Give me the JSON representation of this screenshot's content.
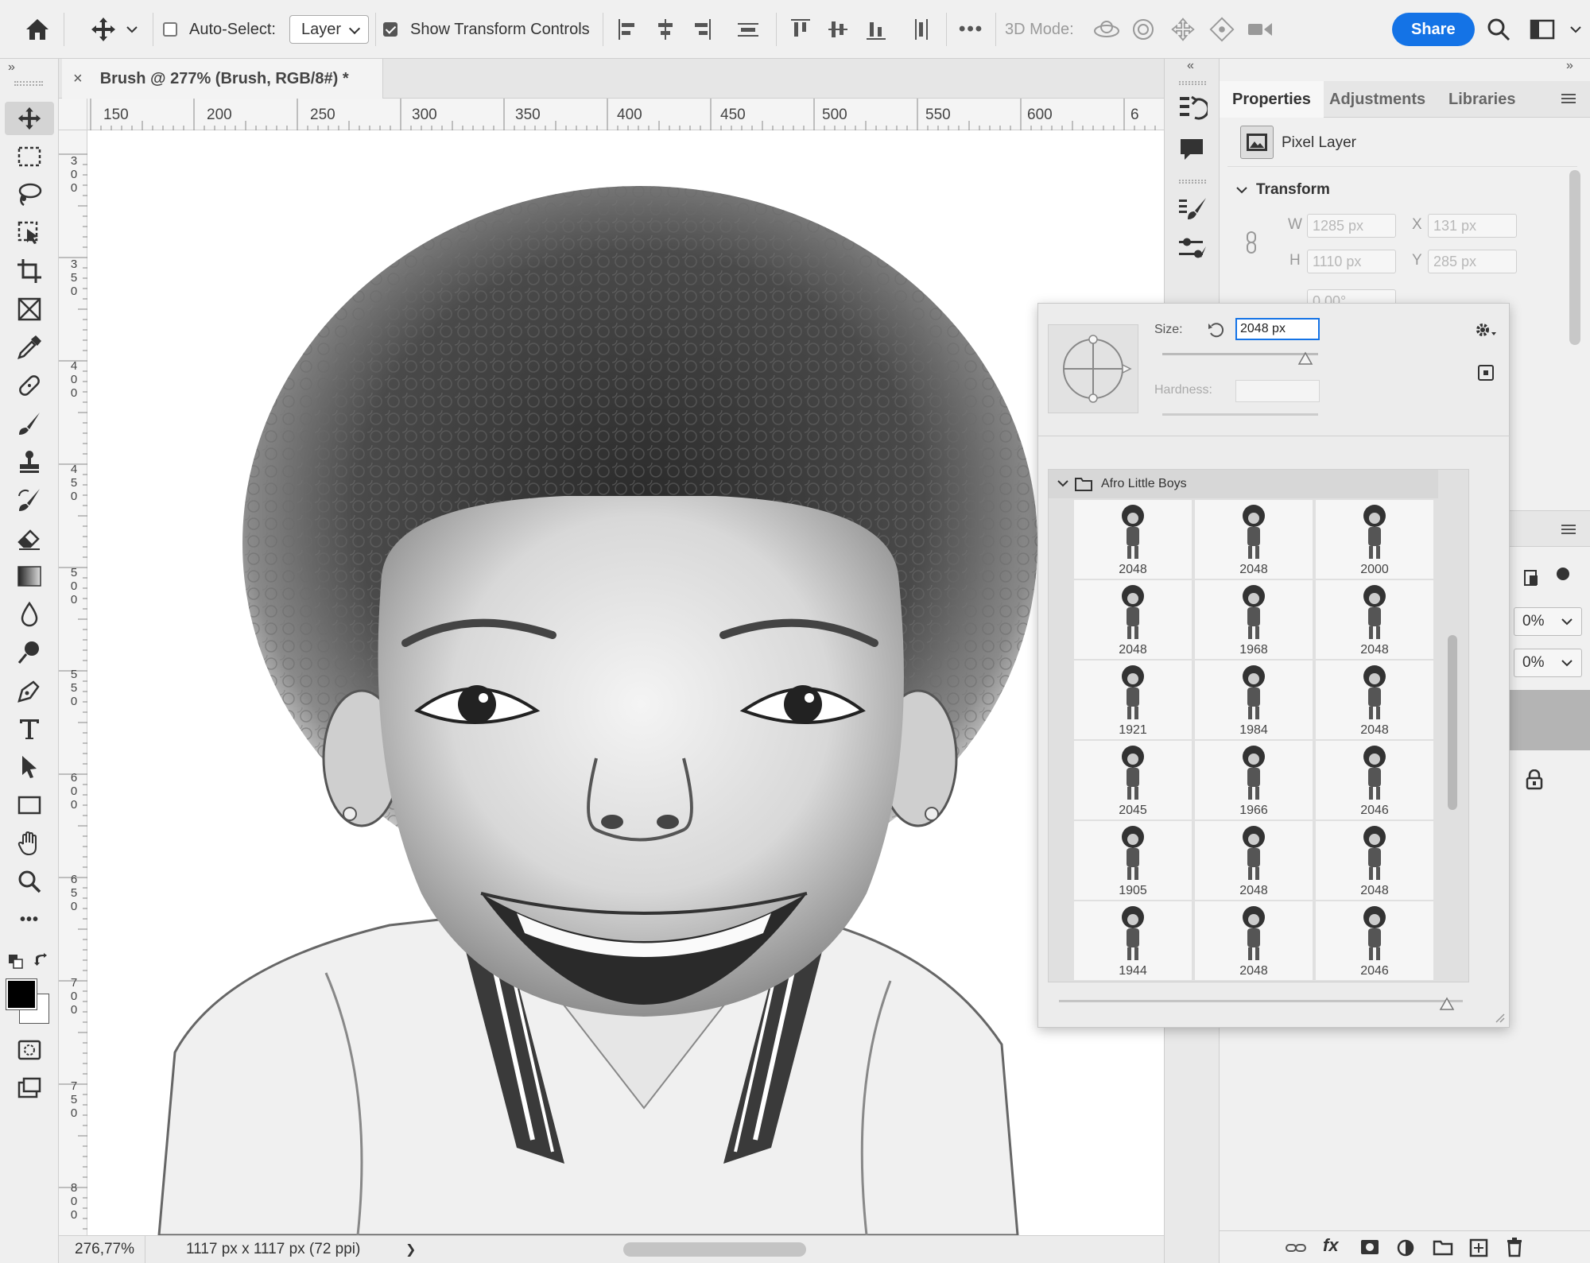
{
  "options_bar": {
    "auto_select_label": "Auto-Select:",
    "auto_select_checked": false,
    "layer_select_value": "Layer",
    "show_transform_label": "Show Transform Controls",
    "show_transform_checked": true,
    "more_label": "•••",
    "mode_3d_label": "3D Mode:",
    "share_label": "Share"
  },
  "document": {
    "tab_close": "×",
    "tab_title": "Brush @ 277% (Brush, RGB/8#) *",
    "h_ruler": [
      "150",
      "200",
      "250",
      "300",
      "350",
      "400",
      "450",
      "500",
      "550",
      "600",
      "6"
    ],
    "v_ruler": [
      [
        "3",
        "0",
        "0"
      ],
      [
        "3",
        "5",
        "0"
      ],
      [
        "4",
        "0",
        "0"
      ],
      [
        "4",
        "5",
        "0"
      ],
      [
        "5",
        "0",
        "0"
      ],
      [
        "5",
        "5",
        "0"
      ],
      [
        "6",
        "0",
        "0"
      ],
      [
        "6",
        "5",
        "0"
      ],
      [
        "7",
        "0",
        "0"
      ],
      [
        "7",
        "5",
        "0"
      ],
      [
        "8",
        "0",
        "0"
      ]
    ]
  },
  "status_bar": {
    "zoom": "276,77%",
    "doc_info": "1117 px x 1117 px (72 ppi)",
    "arrow": "❯"
  },
  "panels": {
    "collapse_left": "»",
    "collapse_mid": "«",
    "collapse_right": "»",
    "tabs": [
      "Properties",
      "Adjustments",
      "Libraries"
    ],
    "layer_type": "Pixel Layer",
    "transform_label": "Transform",
    "w_label": "W",
    "w_value": "1285 px",
    "x_label": "X",
    "x_value": "131 px",
    "h_label": "H",
    "h_value": "1110 px",
    "y_label": "Y",
    "y_value": "285 px",
    "angle_value": "0,00°",
    "opacity_value": "0%",
    "fill_value": "0%"
  },
  "brush_popup": {
    "size_label": "Size:",
    "size_value": "2048 px",
    "hardness_label": "Hardness:",
    "hardness_value": "",
    "group_name": "Afro Little Boys",
    "brushes": [
      "2048",
      "2048",
      "2000",
      "2048",
      "1968",
      "2048",
      "1921",
      "1984",
      "2048",
      "2045",
      "1966",
      "2046",
      "1905",
      "2048",
      "2048",
      "1944",
      "2048",
      "2046"
    ]
  }
}
